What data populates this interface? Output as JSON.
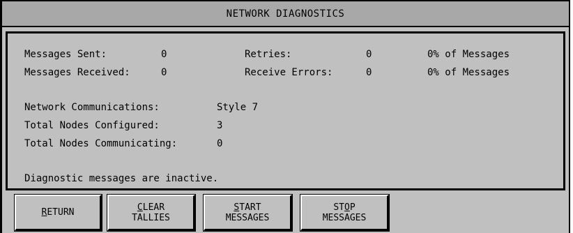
{
  "window": {
    "title": "NETWORK DIAGNOSTICS"
  },
  "stats": {
    "messages_sent_label": "Messages Sent:",
    "messages_sent_value": "0",
    "messages_received_label": "Messages Received:",
    "messages_received_value": "0",
    "retries_label": "Retries:",
    "retries_value": "0",
    "retries_pct": "0% of Messages",
    "receive_errors_label": "Receive Errors:",
    "receive_errors_value": "0",
    "receive_errors_pct": "0% of Messages"
  },
  "network": {
    "communications_label": "Network Communications:",
    "communications_value": "Style 7",
    "nodes_configured_label": "Total Nodes Configured:",
    "nodes_configured_value": "3",
    "nodes_communicating_label": "Total Nodes Communicating:",
    "nodes_communicating_value": "0"
  },
  "status_text": "Diagnostic messages are inactive.",
  "buttons": {
    "return": {
      "mnemonic": "R",
      "rest": "ETURN"
    },
    "clear": {
      "mnemonic": "C",
      "line1_rest": "LEAR",
      "line2": "TALLIES"
    },
    "start": {
      "mnemonic": "S",
      "line1_rest": "TART",
      "line2": "MESSAGES"
    },
    "stop": {
      "line1_a": "ST",
      "mnemonic": "O",
      "line1_b": "P",
      "line2": "MESSAGES"
    }
  }
}
